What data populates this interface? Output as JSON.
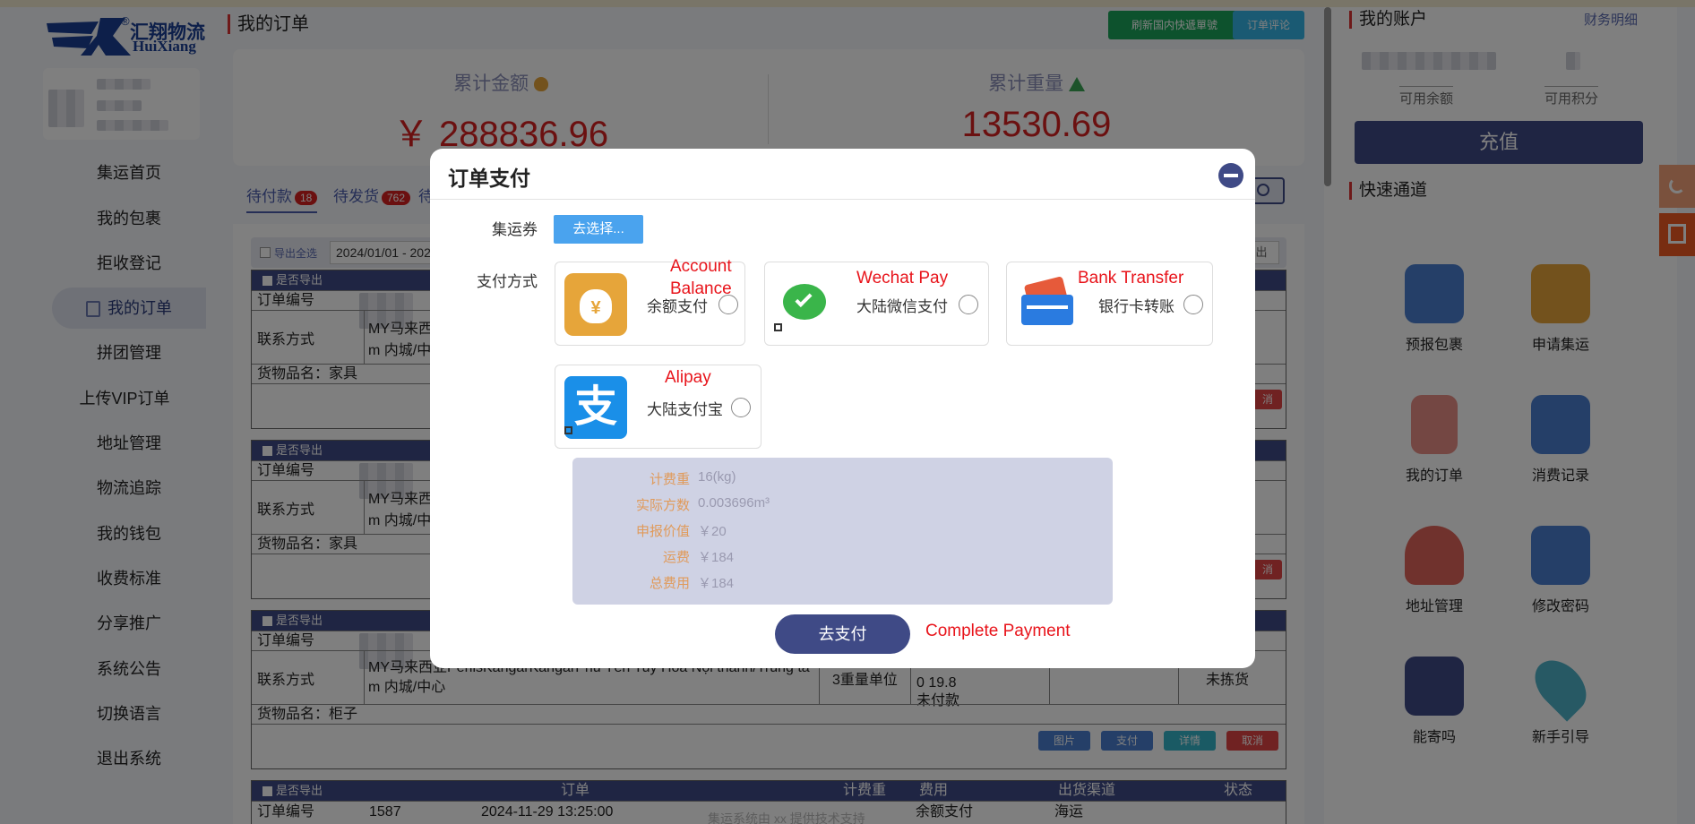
{
  "sidebar": {
    "logo_cn": "汇翔物流",
    "logo_en": "HuiXiang",
    "logo_reg": "®",
    "items": [
      {
        "label": "集运首页"
      },
      {
        "label": "我的包裹"
      },
      {
        "label": "拒收登记"
      },
      {
        "label": "我的订单"
      },
      {
        "label": "拼团管理"
      },
      {
        "label": "上传VIP订单"
      },
      {
        "label": "地址管理"
      },
      {
        "label": "物流追踪"
      },
      {
        "label": "我的钱包"
      },
      {
        "label": "收费标准"
      },
      {
        "label": "分享推广"
      },
      {
        "label": "系统公告"
      },
      {
        "label": "切换语言"
      },
      {
        "label": "退出系统"
      }
    ]
  },
  "main": {
    "title": "我的订单",
    "btn_refresh": "刷新国内快遞單號",
    "btn_review": "订单评论",
    "stats": {
      "amount_label": "累计金额",
      "amount_value": "￥ 288836.96",
      "weight_label": "累计重量",
      "weight_value": "13530.69"
    },
    "tabs": [
      {
        "label": "待付款",
        "count": "18"
      },
      {
        "label": "待发货",
        "count": "762"
      },
      {
        "label": "待"
      }
    ],
    "export_all": "导出全选",
    "date_range": "2024/01/01 - 202",
    "export_label": "是否导出",
    "order_no_label": "订单编号",
    "contact_label": "联系方式",
    "goods_label": "货物品名：",
    "orders": [
      {
        "contact_1": "MY马来西",
        "contact_2": "m 内城/中心",
        "goods": "家具"
      },
      {
        "contact_1": "MY马来西",
        "contact_2": "m 内城/中心",
        "goods": "家具"
      },
      {
        "contact_1": "MY马来西亚PerlisKangarKangarPhú Yên Tuy Hòa Nội thành/Trung tâ",
        "contact_2": "m 内城/中心",
        "goods": "柜子",
        "weight_unit": "3重量单位",
        "fee_1": "0 19.8",
        "fee_2": "未付款",
        "status": "未拣货"
      }
    ],
    "btn_pic": "图片",
    "btn_pay": "支付",
    "btn_detail": "详情",
    "btn_cancel": "取消",
    "btn_cancel_short": "消",
    "export_short": "出",
    "last_order": {
      "col_order": "订单",
      "col_weight": "计费重",
      "col_fee": "费用",
      "col_channel": "出货渠道",
      "col_status": "状态",
      "order_no": "1587",
      "datetime": "2024-11-29 13:25:00",
      "fee": "余额支付",
      "channel": "海运"
    },
    "footer_text": "集运系统由 xx 提供技术支持"
  },
  "right": {
    "account_title": "我的账户",
    "finance_link": "财务明细",
    "balance_label": "可用余额",
    "points_label": "可用积分",
    "recharge": "充值",
    "quick_title": "快速通道",
    "quick": [
      {
        "label": "预报包裹",
        "icon": "package-icon",
        "color": "#4a7fd0"
      },
      {
        "label": "申请集运",
        "icon": "truck-icon",
        "color": "#e6a53a"
      },
      {
        "label": "我的订单",
        "icon": "clipboard-icon",
        "color": "#e98f86"
      },
      {
        "label": "消费记录",
        "icon": "card-icon",
        "color": "#4a7fd0"
      },
      {
        "label": "地址管理",
        "icon": "user-location-icon",
        "color": "#e0645a"
      },
      {
        "label": "修改密码",
        "icon": "gear-icon",
        "color": "#4a7fd0"
      },
      {
        "label": "能寄吗",
        "icon": "question-box-icon",
        "color": "#3f4a86"
      },
      {
        "label": "新手引导",
        "icon": "map-pin-icon",
        "color": "#4fb3c9"
      }
    ]
  },
  "modal": {
    "title": "订单支付",
    "coupon_label": "集运券",
    "coupon_button": "去选择...",
    "pay_method_label": "支付方式",
    "methods": [
      {
        "name": "余额支付",
        "annotation_1": "Account",
        "annotation_2": "Balance",
        "icon": "money-bag-icon"
      },
      {
        "name": "大陆微信支付",
        "annotation": "Wechat Pay",
        "icon": "wechat-icon"
      },
      {
        "name": "银行卡转账",
        "annotation": "Bank Transfer",
        "icon": "bank-card-icon"
      },
      {
        "name": "大陆支付宝",
        "annotation": "Alipay",
        "icon": "alipay-icon"
      }
    ],
    "summary": [
      {
        "label": "计费重",
        "value": "16(kg)"
      },
      {
        "label": "实际方数",
        "value": "0.003696m³"
      },
      {
        "label": "申报价值",
        "value": "￥20"
      },
      {
        "label": "运费",
        "value": "￥184"
      },
      {
        "label": "总费用",
        "value": "￥184"
      }
    ],
    "pay_button": "去支付",
    "pay_annotation": "Complete Payment"
  },
  "colors": {
    "brand": "#3f4a86",
    "accent_red": "#d62020",
    "annotation_red": "#e8141b"
  }
}
